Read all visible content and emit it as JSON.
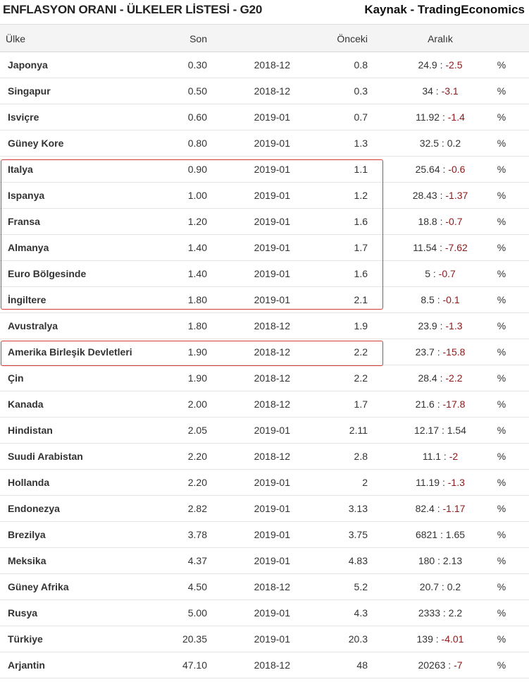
{
  "header": {
    "title": "ENFLASYON ORANI - ÜLKELER LİSTESİ - G20",
    "source": "Kaynak - TradingEconomics"
  },
  "chart_data": {
    "type": "table",
    "columns": [
      "Ülke",
      "Son",
      "",
      "Önceki",
      "Aralık",
      ""
    ],
    "rows": [
      {
        "country": "Japonya",
        "last": "0.30",
        "date": "2018-12",
        "previous": "0.8",
        "range_high": "24.9",
        "range_low": "-2.5",
        "unit": "%"
      },
      {
        "country": "Singapur",
        "last": "0.50",
        "date": "2018-12",
        "previous": "0.3",
        "range_high": "34",
        "range_low": "-3.1",
        "unit": "%"
      },
      {
        "country": "Isviçre",
        "last": "0.60",
        "date": "2019-01",
        "previous": "0.7",
        "range_high": "11.92",
        "range_low": "-1.4",
        "unit": "%"
      },
      {
        "country": "Güney Kore",
        "last": "0.80",
        "date": "2019-01",
        "previous": "1.3",
        "range_high": "32.5",
        "range_low": "0.2",
        "unit": "%"
      },
      {
        "country": "Italya",
        "last": "0.90",
        "date": "2019-01",
        "previous": "1.1",
        "range_high": "25.64",
        "range_low": "-0.6",
        "unit": "%"
      },
      {
        "country": "Ispanya",
        "last": "1.00",
        "date": "2019-01",
        "previous": "1.2",
        "range_high": "28.43",
        "range_low": "-1.37",
        "unit": "%"
      },
      {
        "country": "Fransa",
        "last": "1.20",
        "date": "2019-01",
        "previous": "1.6",
        "range_high": "18.8",
        "range_low": "-0.7",
        "unit": "%"
      },
      {
        "country": "Almanya",
        "last": "1.40",
        "date": "2019-01",
        "previous": "1.7",
        "range_high": "11.54",
        "range_low": "-7.62",
        "unit": "%"
      },
      {
        "country": "Euro Bölgesinde",
        "last": "1.40",
        "date": "2019-01",
        "previous": "1.6",
        "range_high": "5",
        "range_low": "-0.7",
        "unit": "%"
      },
      {
        "country": "İngiltere",
        "last": "1.80",
        "date": "2019-01",
        "previous": "2.1",
        "range_high": "8.5",
        "range_low": "-0.1",
        "unit": "%"
      },
      {
        "country": "Avustralya",
        "last": "1.80",
        "date": "2018-12",
        "previous": "1.9",
        "range_high": "23.9",
        "range_low": "-1.3",
        "unit": "%"
      },
      {
        "country": "Amerika Birleşik Devletleri",
        "last": "1.90",
        "date": "2018-12",
        "previous": "2.2",
        "range_high": "23.7",
        "range_low": "-15.8",
        "unit": "%"
      },
      {
        "country": "Çin",
        "last": "1.90",
        "date": "2018-12",
        "previous": "2.2",
        "range_high": "28.4",
        "range_low": "-2.2",
        "unit": "%"
      },
      {
        "country": "Kanada",
        "last": "2.00",
        "date": "2018-12",
        "previous": "1.7",
        "range_high": "21.6",
        "range_low": "-17.8",
        "unit": "%"
      },
      {
        "country": "Hindistan",
        "last": "2.05",
        "date": "2019-01",
        "previous": "2.11",
        "range_high": "12.17",
        "range_low": "1.54",
        "unit": "%"
      },
      {
        "country": "Suudi Arabistan",
        "last": "2.20",
        "date": "2018-12",
        "previous": "2.8",
        "range_high": "11.1",
        "range_low": "-2",
        "unit": "%"
      },
      {
        "country": "Hollanda",
        "last": "2.20",
        "date": "2019-01",
        "previous": "2",
        "range_high": "11.19",
        "range_low": "-1.3",
        "unit": "%"
      },
      {
        "country": "Endonezya",
        "last": "2.82",
        "date": "2019-01",
        "previous": "3.13",
        "range_high": "82.4",
        "range_low": "-1.17",
        "unit": "%"
      },
      {
        "country": "Brezilya",
        "last": "3.78",
        "date": "2019-01",
        "previous": "3.75",
        "range_high": "6821",
        "range_low": "1.65",
        "unit": "%"
      },
      {
        "country": "Meksika",
        "last": "4.37",
        "date": "2019-01",
        "previous": "4.83",
        "range_high": "180",
        "range_low": "2.13",
        "unit": "%"
      },
      {
        "country": "Güney Afrika",
        "last": "4.50",
        "date": "2018-12",
        "previous": "5.2",
        "range_high": "20.7",
        "range_low": "0.2",
        "unit": "%"
      },
      {
        "country": "Rusya",
        "last": "5.00",
        "date": "2019-01",
        "previous": "4.3",
        "range_high": "2333",
        "range_low": "2.2",
        "unit": "%"
      },
      {
        "country": "Türkiye",
        "last": "20.35",
        "date": "2019-01",
        "previous": "20.3",
        "range_high": "139",
        "range_low": "-4.01",
        "unit": "%"
      },
      {
        "country": "Arjantin",
        "last": "47.10",
        "date": "2018-12",
        "previous": "48",
        "range_high": "20263",
        "range_low": "-7",
        "unit": "%"
      }
    ],
    "highlight_color": "#d63b3b",
    "negative_color": "#8b1a1a"
  }
}
